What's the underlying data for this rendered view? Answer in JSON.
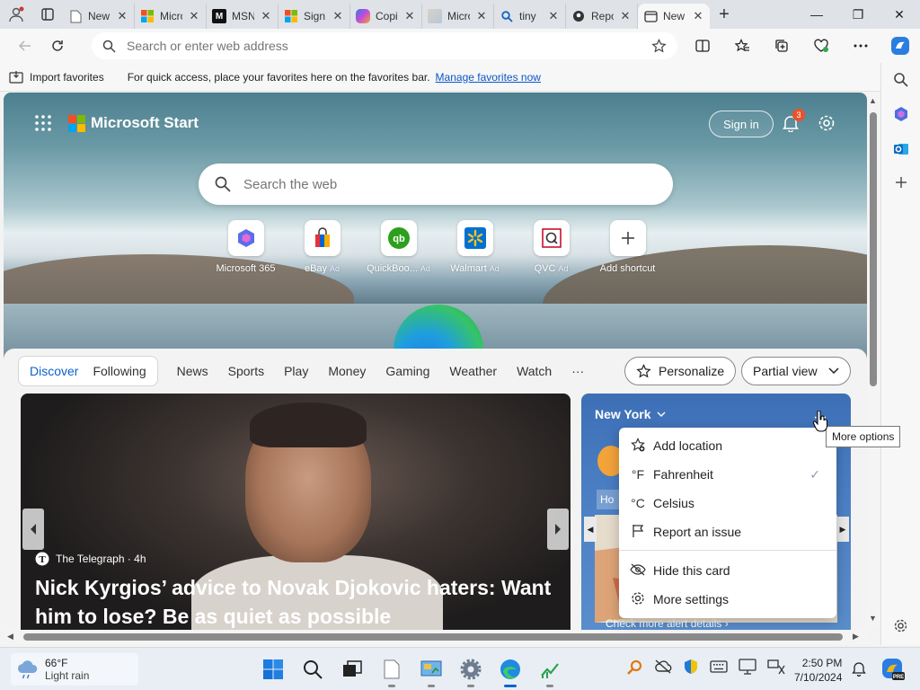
{
  "tabs": [
    {
      "title": "New tab",
      "icon": "page-icon"
    },
    {
      "title": "Microsoft",
      "icon": "microsoft-icon"
    },
    {
      "title": "MSN",
      "icon": "msn-icon"
    },
    {
      "title": "Sign in",
      "icon": "microsoft-icon"
    },
    {
      "title": "Copilot",
      "icon": "copilot-icon"
    },
    {
      "title": "Microsoft",
      "icon": "microsoft-icon"
    },
    {
      "title": "tiny",
      "icon": "search-icon"
    },
    {
      "title": "Report",
      "icon": "report-icon"
    },
    {
      "title": "New tab",
      "icon": "edge-page-icon"
    }
  ],
  "address_bar": {
    "placeholder": "Search or enter web address"
  },
  "favorites_bar": {
    "import_label": "Import favorites",
    "message": "For quick access, place your favorites here on the favorites bar.",
    "link": "Manage favorites now"
  },
  "header": {
    "logo_text": "Microsoft Start",
    "signin": "Sign in",
    "notification_count": "3"
  },
  "search": {
    "placeholder": "Search the web"
  },
  "quick_links": [
    {
      "label": "Microsoft 365",
      "ad": ""
    },
    {
      "label": "eBay",
      "ad": "Ad"
    },
    {
      "label": "QuickBoo...",
      "ad": "Ad"
    },
    {
      "label": "Walmart",
      "ad": "Ad"
    },
    {
      "label": "QVC",
      "ad": "Ad"
    },
    {
      "label": "Add shortcut",
      "ad": ""
    }
  ],
  "feed_nav": {
    "discover": "Discover",
    "following": "Following",
    "items": [
      "News",
      "Sports",
      "Play",
      "Money",
      "Gaming",
      "Weather",
      "Watch"
    ],
    "more": "···",
    "personalize": "Personalize",
    "view": "Partial view"
  },
  "news_card": {
    "source": "The Telegraph · 4h",
    "headline": "Nick Kyrgios’ advice to Novak Djokovic haters: Want him to lose? Be as quiet as possible"
  },
  "weather_card": {
    "city": "New York",
    "tab_label": "Ho",
    "alert_link": "Check more alert details"
  },
  "context_menu": {
    "items": [
      {
        "label": "Add location",
        "icon": "add-location-icon"
      },
      {
        "label": "Fahrenheit",
        "icon": "fahrenheit-icon",
        "checked": true
      },
      {
        "label": "Celsius",
        "icon": "celsius-icon"
      },
      {
        "label": "Report an issue",
        "icon": "flag-icon"
      },
      {
        "label": "Hide this card",
        "icon": "hide-icon"
      },
      {
        "label": "More settings",
        "icon": "gear-icon"
      }
    ],
    "fahrenheit_symbol": "°F",
    "celsius_symbol": "°C"
  },
  "tooltip": "More options",
  "taskbar": {
    "temp": "66°F",
    "condition": "Light rain",
    "time": "2:50 PM",
    "date": "7/10/2024"
  },
  "colors": {
    "accent": "#0b62c9",
    "badge": "#e8532a",
    "weather_card": "#4c80c4"
  }
}
